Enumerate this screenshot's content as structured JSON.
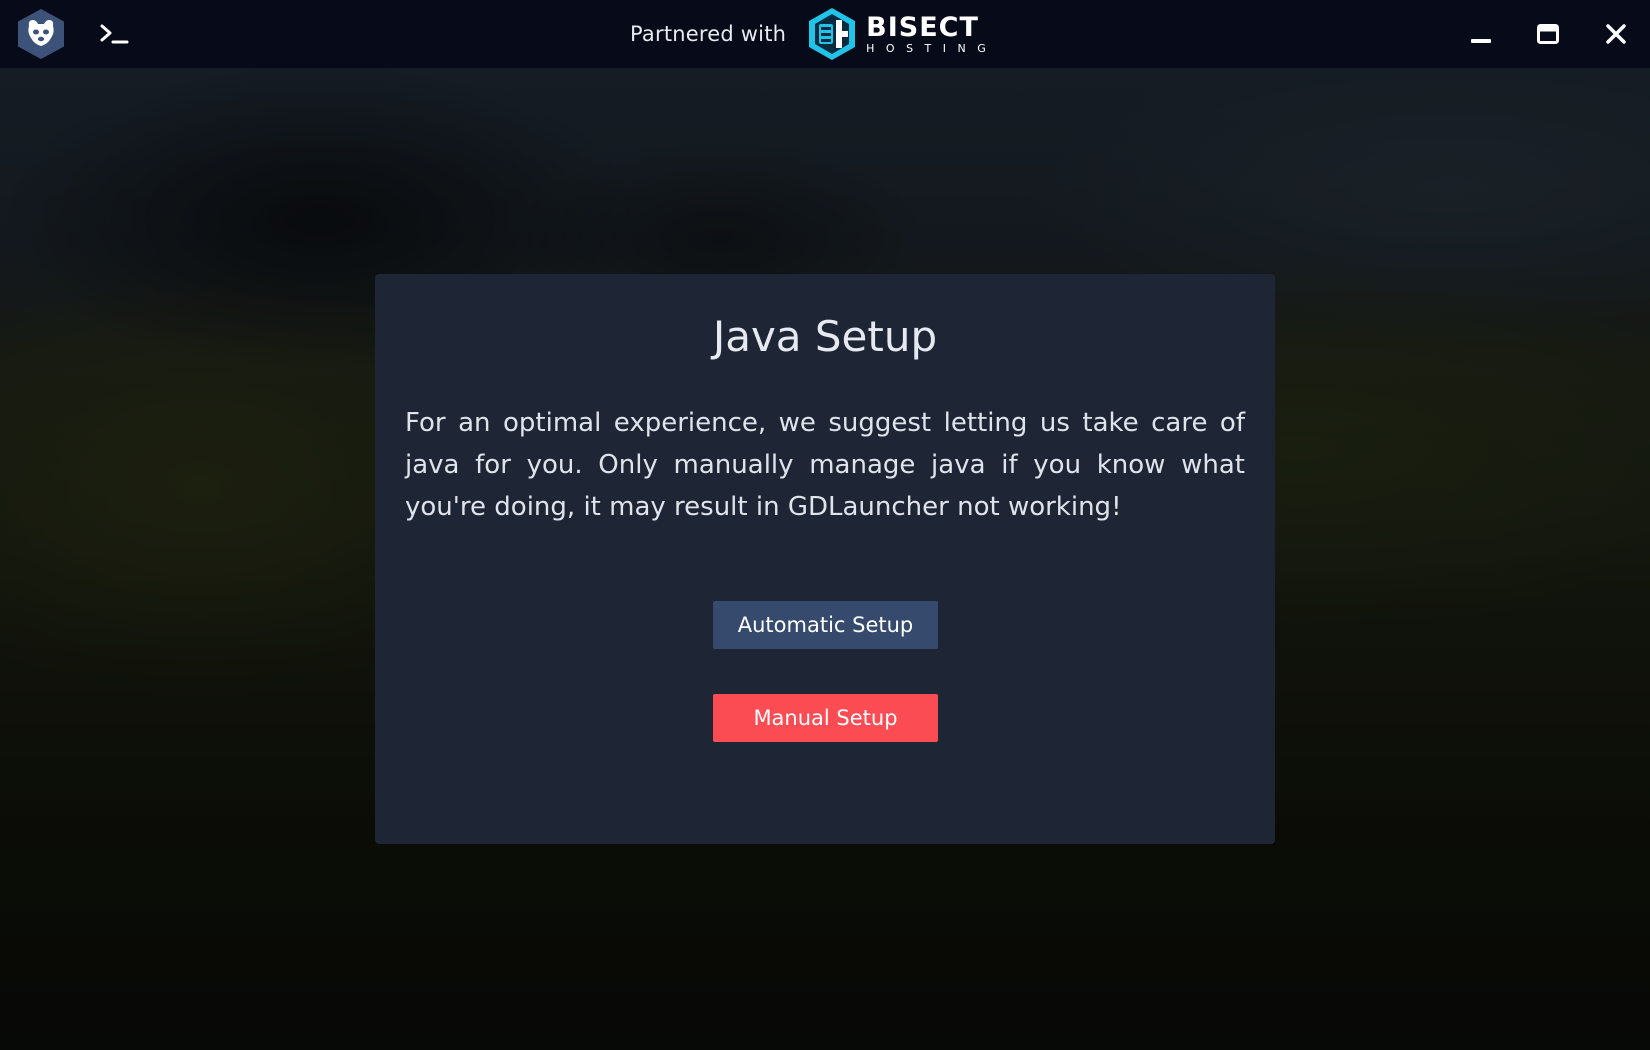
{
  "titlebar": {
    "partner_text": "Partnered with",
    "brand_name": "BISECT",
    "brand_sub": "HOSTING",
    "icons": {
      "app_logo": "gdlauncher-logo-icon",
      "terminal": "terminal-icon",
      "minimize": "minimize-icon",
      "maximize": "maximize-icon",
      "close": "close-icon",
      "brand": "bisect-hosting-logo"
    }
  },
  "modal": {
    "title": "Java Setup",
    "description": "For an optimal experience, we suggest letting us take care of java for you. Only manually manage java if you know what you're doing, it may result in GDLauncher not working!",
    "automatic_label": "Automatic Setup",
    "manual_label": "Manual Setup"
  },
  "colors": {
    "titlebar_bg": "#070b19",
    "modal_bg": "#1e2636",
    "automatic_button": "#364a6d",
    "manual_button": "#fb4b53",
    "brand_accent": "#1fc4e8"
  }
}
